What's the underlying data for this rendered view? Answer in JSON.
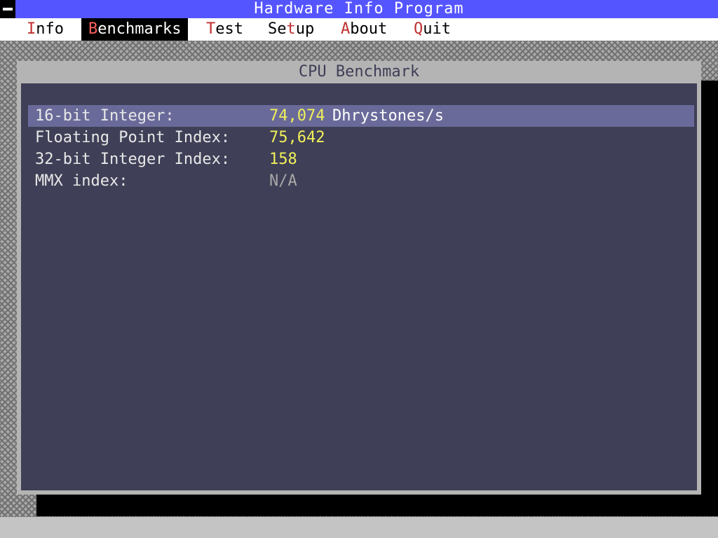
{
  "app": {
    "title": "Hardware Info Program"
  },
  "menu": {
    "items": [
      {
        "hot": "I",
        "rest": "nfo",
        "active": false
      },
      {
        "hot": "B",
        "rest": "enchmarks",
        "active": true
      },
      {
        "hot": "T",
        "rest": "est",
        "active": false
      },
      {
        "hot": "",
        "rest": "Se",
        "hot2": "t",
        "rest2": "up",
        "active": false
      },
      {
        "hot": "A",
        "rest": "bout",
        "active": false
      },
      {
        "hot": "Q",
        "rest": "uit",
        "active": false
      }
    ]
  },
  "window": {
    "title": "CPU Benchmark",
    "rows": [
      {
        "label": "16-bit Integer:",
        "value": "74,074",
        "unit": "Dhrystones/s",
        "selected": true
      },
      {
        "label": "Floating Point Index:",
        "value": "75,642",
        "unit": "",
        "selected": false
      },
      {
        "label": "32-bit Integer Index:",
        "value": "158",
        "unit": "",
        "selected": false
      },
      {
        "label": "MMX index:",
        "value": "N/A",
        "unit": "",
        "selected": false
      }
    ]
  },
  "colors": {
    "titlebar": "#5555ff",
    "window_body": "#3f3f57",
    "selected_row": "#6a6a9a",
    "value": "#f0f05a",
    "hotkey": "#c03030"
  }
}
